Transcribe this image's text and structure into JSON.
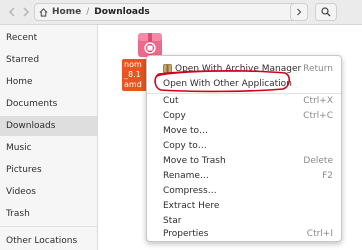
{
  "headerbar": {
    "back_icon": "chevron-left-icon",
    "forward_icon": "chevron-right-icon",
    "home_label": "Home",
    "separator": "/",
    "current_folder": "Downloads",
    "more_icon": "chevron-right-icon",
    "search_icon": "search-icon"
  },
  "sidebar": {
    "items": [
      {
        "label": "Recent",
        "icon": "clock-icon"
      },
      {
        "label": "Starred",
        "icon": "star-icon"
      },
      {
        "label": "Home",
        "icon": "home-icon"
      },
      {
        "label": "Documents",
        "icon": "document-icon"
      },
      {
        "label": "Downloads",
        "icon": "download-icon",
        "active": true
      },
      {
        "label": "Music",
        "icon": "music-icon"
      },
      {
        "label": "Pictures",
        "icon": "picture-icon"
      },
      {
        "label": "Videos",
        "icon": "video-icon"
      },
      {
        "label": "Trash",
        "icon": "trash-icon"
      },
      {
        "label": "Other Locations",
        "icon": "plus-icon"
      }
    ]
  },
  "file": {
    "name_lines": [
      "nom",
      "_8.1",
      "amd"
    ],
    "icon": "package-icon",
    "accent": "#e95420"
  },
  "context_menu": {
    "items": [
      {
        "label": "Open With Archive Manager",
        "accel": "Return",
        "icon": "archive-manager-icon"
      },
      {
        "label": "Open With Other Application",
        "accel": ""
      },
      {
        "label": "Cut",
        "accel": "Ctrl+X"
      },
      {
        "label": "Copy",
        "accel": "Ctrl+C"
      },
      {
        "label": "Move to…",
        "accel": ""
      },
      {
        "label": "Copy to…",
        "accel": ""
      },
      {
        "label": "Move to Trash",
        "accel": "Delete"
      },
      {
        "label": "Rename…",
        "accel": "F2"
      },
      {
        "label": "Compress…",
        "accel": ""
      },
      {
        "label": "Extract Here",
        "accel": ""
      },
      {
        "label": "Star",
        "accel": ""
      },
      {
        "label": "Properties",
        "accel": "Ctrl+I"
      }
    ]
  },
  "annotation": {
    "color": "#d0021b"
  }
}
